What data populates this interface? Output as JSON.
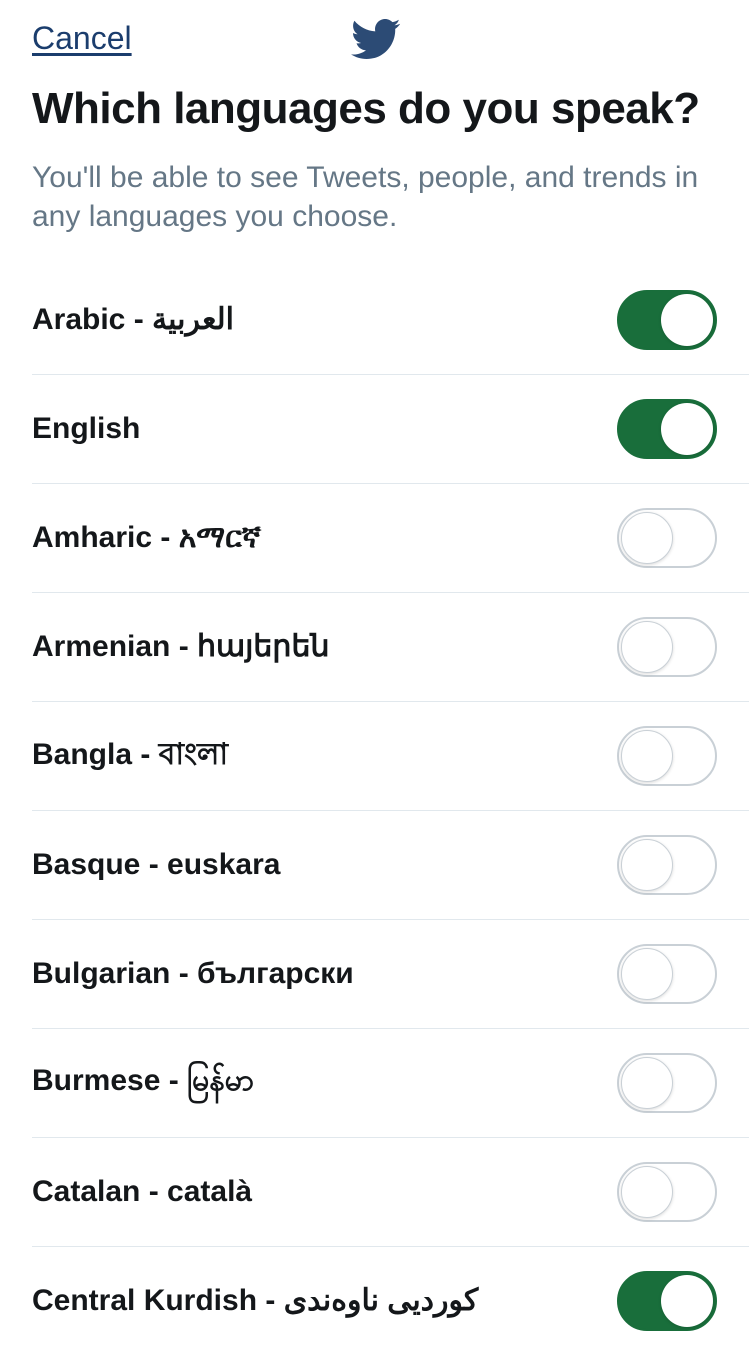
{
  "header": {
    "cancel": "Cancel"
  },
  "title": "Which languages do you speak?",
  "subtitle": "You'll be able to see Tweets, people, and trends in any languages you choose.",
  "languages": [
    {
      "label": "Arabic - العربية",
      "on": true
    },
    {
      "label": "English",
      "on": true
    },
    {
      "label": "Amharic - አማርኛ",
      "on": false
    },
    {
      "label": "Armenian - հայերեն",
      "on": false
    },
    {
      "label": "Bangla - বাংলা",
      "on": false
    },
    {
      "label": "Basque - euskara",
      "on": false
    },
    {
      "label": "Bulgarian - български",
      "on": false
    },
    {
      "label": "Burmese - မြန်မာ",
      "on": false
    },
    {
      "label": "Catalan - català",
      "on": false
    },
    {
      "label": "Central Kurdish - کوردیی ناوەندی",
      "on": true
    }
  ]
}
